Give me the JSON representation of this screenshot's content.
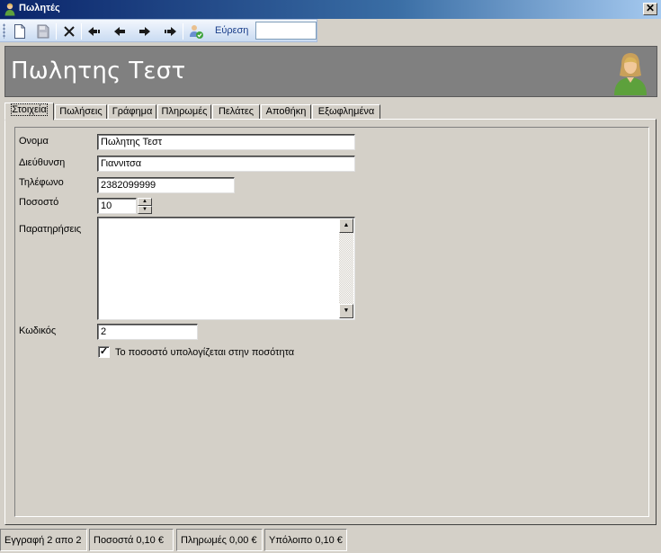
{
  "window": {
    "title": "Πωλητές",
    "icon": "user-icon"
  },
  "toolbar": {
    "buttons": [
      {
        "name": "new-record-button",
        "icon": "new-document-icon"
      },
      {
        "name": "save-button",
        "icon": "save-icon"
      },
      {
        "name": "delete-button",
        "icon": "close-icon"
      },
      {
        "name": "first-record-button",
        "icon": "first-arrow-icon"
      },
      {
        "name": "previous-record-button",
        "icon": "left-arrow-icon"
      },
      {
        "name": "next-record-button",
        "icon": "right-arrow-icon"
      },
      {
        "name": "last-record-button",
        "icon": "last-arrow-icon"
      },
      {
        "name": "find-user-button",
        "icon": "user-search-icon"
      }
    ],
    "search_label": "Εύρεση",
    "search_value": ""
  },
  "header": {
    "title": "Πωλητης Τεστ"
  },
  "tabs": [
    {
      "label": "Στοιχεία",
      "active": true
    },
    {
      "label": "Πωλήσεις",
      "active": false
    },
    {
      "label": "Γράφημα",
      "active": false
    },
    {
      "label": "Πληρωμές",
      "active": false
    },
    {
      "label": "Πελάτες",
      "active": false
    },
    {
      "label": "Αποθήκη",
      "active": false
    },
    {
      "label": "Εξωφλημένα",
      "active": false
    }
  ],
  "form": {
    "name_label": "Ονομα",
    "name_value": "Πωλητης Τεστ",
    "address_label": "Διεύθυνση",
    "address_value": "Γιαννιτσα",
    "phone_label": "Τηλέφωνο",
    "phone_value": "2382099999",
    "percent_label": "Ποσοστό",
    "percent_value": "10",
    "notes_label": "Παρατηρήσεις",
    "notes_value": "",
    "code_label": "Κωδικός",
    "code_value": "2",
    "checkbox_label": "Το ποσοστό υπολογίζεται στην ποσότητα",
    "checkbox_checked": true
  },
  "status": {
    "record": "Εγγραφή 2 απο 2",
    "percent": "Ποσοστά 0,10 €",
    "payments": "Πληρωμές 0,00 €",
    "balance": "Υπόλοιπο 0,10 €"
  },
  "colors": {
    "header_bg": "#808080",
    "window_bg": "#d4d0c8",
    "titlebar": "#0a246a",
    "toolbar": "#c9dbf2"
  }
}
